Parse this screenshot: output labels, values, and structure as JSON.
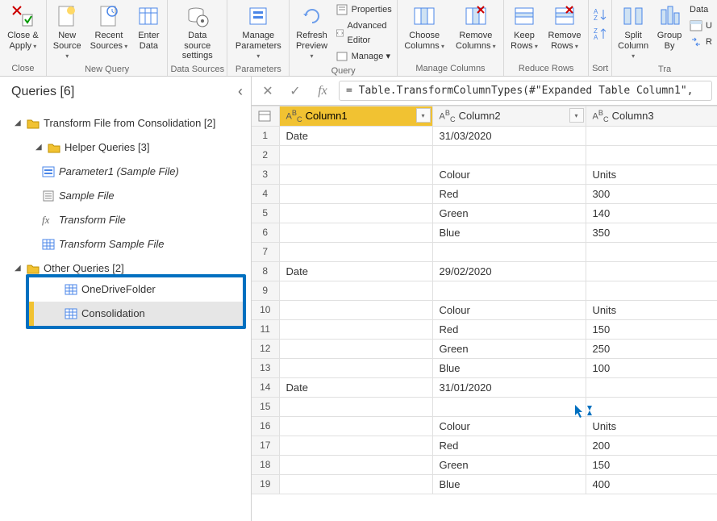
{
  "ribbon": {
    "close_apply": "Close &\nApply",
    "close_group": "Close",
    "new_source": "New\nSource",
    "recent_sources": "Recent\nSources",
    "enter_data": "Enter\nData",
    "new_query_group": "New Query",
    "data_source_settings": "Data source\nsettings",
    "data_sources_group": "Data Sources",
    "manage_parameters": "Manage\nParameters",
    "parameters_group": "Parameters",
    "refresh_preview": "Refresh\nPreview",
    "properties": "Properties",
    "advanced_editor": "Advanced Editor",
    "manage": "Manage",
    "query_group": "Query",
    "choose_columns": "Choose\nColumns",
    "remove_columns": "Remove\nColumns",
    "manage_columns_group": "Manage Columns",
    "keep_rows": "Keep\nRows",
    "remove_rows": "Remove\nRows",
    "reduce_rows_group": "Reduce Rows",
    "sort_group": "Sort",
    "split_column": "Split\nColumn",
    "group_by": "Group\nBy",
    "data_type": "Data",
    "tra_group": "Tra"
  },
  "sidebar": {
    "title": "Queries [6]",
    "items": [
      {
        "label": "Transform File from Consolidation [2]",
        "kind": "folder",
        "depth": 1,
        "expanded": true
      },
      {
        "label": "Helper Queries [3]",
        "kind": "folder",
        "depth": 2,
        "expanded": true
      },
      {
        "label": "Parameter1 (Sample File)",
        "kind": "param",
        "depth": 3,
        "italic": true
      },
      {
        "label": "Sample File",
        "kind": "file",
        "depth": 3,
        "italic": true
      },
      {
        "label": "Transform File",
        "kind": "fx",
        "depth": 3,
        "italic": true
      },
      {
        "label": "Transform Sample File",
        "kind": "table",
        "depth": 3,
        "italic": true
      },
      {
        "label": "Other Queries [2]",
        "kind": "folder",
        "depth": 1,
        "expanded": true
      },
      {
        "label": "OneDriveFolder",
        "kind": "table",
        "depth": 2,
        "highlighted_above": true
      },
      {
        "label": "Consolidation",
        "kind": "table",
        "depth": 2,
        "selected": true,
        "highlighted": true
      }
    ]
  },
  "formula": {
    "value": "= Table.TransformColumnTypes(#\"Expanded Table Column1\","
  },
  "table": {
    "columns": [
      "Column1",
      "Column2",
      "Column3"
    ],
    "type_prefix": "A¹₂₃",
    "selected_col": 0,
    "rows": [
      [
        "Date",
        "31/03/2020",
        ""
      ],
      [
        "",
        "",
        ""
      ],
      [
        "",
        "Colour",
        "Units"
      ],
      [
        "",
        "Red",
        "300"
      ],
      [
        "",
        "Green",
        "140"
      ],
      [
        "",
        "Blue",
        "350"
      ],
      [
        "",
        "",
        ""
      ],
      [
        "Date",
        "29/02/2020",
        ""
      ],
      [
        "",
        "",
        ""
      ],
      [
        "",
        "Colour",
        "Units"
      ],
      [
        "",
        "Red",
        "150"
      ],
      [
        "",
        "Green",
        "250"
      ],
      [
        "",
        "Blue",
        "100"
      ],
      [
        "Date",
        "31/01/2020",
        ""
      ],
      [
        "",
        "",
        ""
      ],
      [
        "",
        "Colour",
        "Units"
      ],
      [
        "",
        "Red",
        "200"
      ],
      [
        "",
        "Green",
        "150"
      ],
      [
        "",
        "Blue",
        "400"
      ]
    ]
  }
}
